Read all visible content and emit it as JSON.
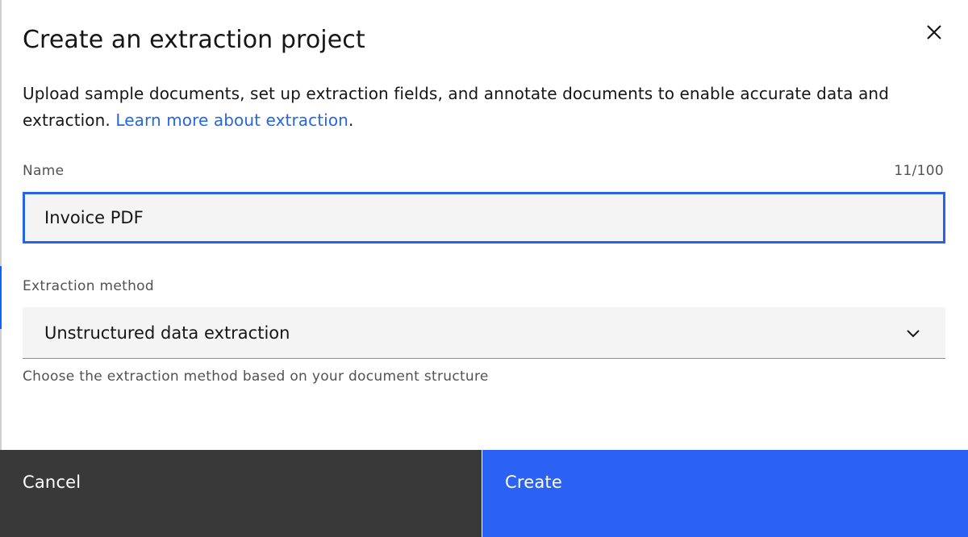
{
  "modal": {
    "title": "Create an extraction project",
    "description": "Upload sample documents, set up extraction fields, and annotate documents to enable accurate data and extraction.",
    "learn_more_link": "Learn more about extraction",
    "description_end": "."
  },
  "name_field": {
    "label": "Name",
    "counter": "11/100",
    "value": "Invoice PDF"
  },
  "method_field": {
    "label": "Extraction method",
    "selected": "Unstructured data extraction",
    "helper": "Choose the extraction method based on your document structure"
  },
  "footer": {
    "cancel_label": "Cancel",
    "create_label": "Create"
  },
  "colors": {
    "accent": "#2566e8",
    "primary_button": "#2c62f4",
    "secondary_button": "#393939"
  },
  "icons": {
    "close": "close-icon",
    "chevron": "chevron-down-icon"
  }
}
